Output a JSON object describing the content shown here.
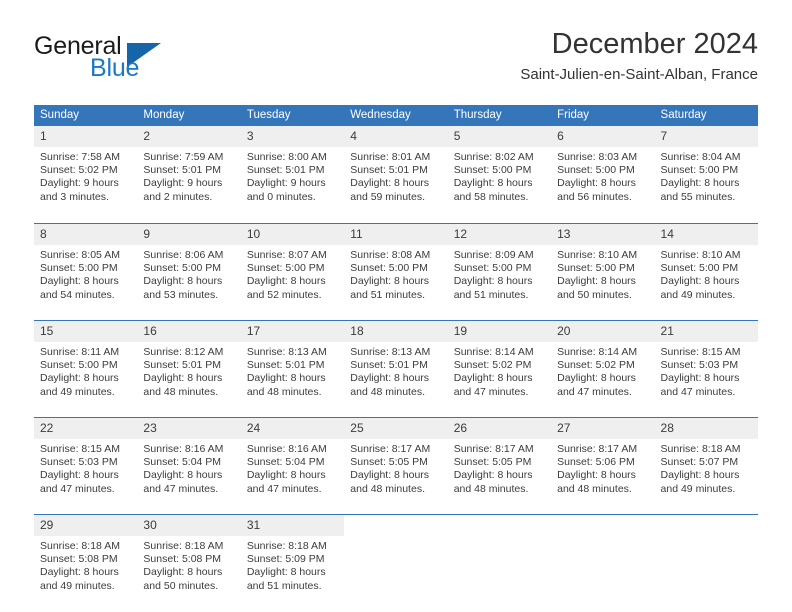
{
  "brand": {
    "name_top": "General",
    "name_bottom": "Blue",
    "triangle_color": "#1565a8",
    "blue_color": "#1b78c8"
  },
  "header": {
    "title": "December 2024",
    "subtitle": "Saint-Julien-en-Saint-Alban, France"
  },
  "theme": {
    "header_blue": "#3576ba",
    "daynum_gray": "#efefef",
    "text": "#3c3c3c"
  },
  "calendar": {
    "weekday_headers": [
      "Sunday",
      "Monday",
      "Tuesday",
      "Wednesday",
      "Thursday",
      "Friday",
      "Saturday"
    ],
    "weeks": [
      [
        {
          "day": "1",
          "info": "Sunrise: 7:58 AM\nSunset: 5:02 PM\nDaylight: 9 hours\nand 3 minutes."
        },
        {
          "day": "2",
          "info": "Sunrise: 7:59 AM\nSunset: 5:01 PM\nDaylight: 9 hours\nand 2 minutes."
        },
        {
          "day": "3",
          "info": "Sunrise: 8:00 AM\nSunset: 5:01 PM\nDaylight: 9 hours\nand 0 minutes."
        },
        {
          "day": "4",
          "info": "Sunrise: 8:01 AM\nSunset: 5:01 PM\nDaylight: 8 hours\nand 59 minutes."
        },
        {
          "day": "5",
          "info": "Sunrise: 8:02 AM\nSunset: 5:00 PM\nDaylight: 8 hours\nand 58 minutes."
        },
        {
          "day": "6",
          "info": "Sunrise: 8:03 AM\nSunset: 5:00 PM\nDaylight: 8 hours\nand 56 minutes."
        },
        {
          "day": "7",
          "info": "Sunrise: 8:04 AM\nSunset: 5:00 PM\nDaylight: 8 hours\nand 55 minutes."
        }
      ],
      [
        {
          "day": "8",
          "info": "Sunrise: 8:05 AM\nSunset: 5:00 PM\nDaylight: 8 hours\nand 54 minutes."
        },
        {
          "day": "9",
          "info": "Sunrise: 8:06 AM\nSunset: 5:00 PM\nDaylight: 8 hours\nand 53 minutes."
        },
        {
          "day": "10",
          "info": "Sunrise: 8:07 AM\nSunset: 5:00 PM\nDaylight: 8 hours\nand 52 minutes."
        },
        {
          "day": "11",
          "info": "Sunrise: 8:08 AM\nSunset: 5:00 PM\nDaylight: 8 hours\nand 51 minutes."
        },
        {
          "day": "12",
          "info": "Sunrise: 8:09 AM\nSunset: 5:00 PM\nDaylight: 8 hours\nand 51 minutes."
        },
        {
          "day": "13",
          "info": "Sunrise: 8:10 AM\nSunset: 5:00 PM\nDaylight: 8 hours\nand 50 minutes."
        },
        {
          "day": "14",
          "info": "Sunrise: 8:10 AM\nSunset: 5:00 PM\nDaylight: 8 hours\nand 49 minutes."
        }
      ],
      [
        {
          "day": "15",
          "info": "Sunrise: 8:11 AM\nSunset: 5:00 PM\nDaylight: 8 hours\nand 49 minutes."
        },
        {
          "day": "16",
          "info": "Sunrise: 8:12 AM\nSunset: 5:01 PM\nDaylight: 8 hours\nand 48 minutes."
        },
        {
          "day": "17",
          "info": "Sunrise: 8:13 AM\nSunset: 5:01 PM\nDaylight: 8 hours\nand 48 minutes."
        },
        {
          "day": "18",
          "info": "Sunrise: 8:13 AM\nSunset: 5:01 PM\nDaylight: 8 hours\nand 48 minutes."
        },
        {
          "day": "19",
          "info": "Sunrise: 8:14 AM\nSunset: 5:02 PM\nDaylight: 8 hours\nand 47 minutes."
        },
        {
          "day": "20",
          "info": "Sunrise: 8:14 AM\nSunset: 5:02 PM\nDaylight: 8 hours\nand 47 minutes."
        },
        {
          "day": "21",
          "info": "Sunrise: 8:15 AM\nSunset: 5:03 PM\nDaylight: 8 hours\nand 47 minutes."
        }
      ],
      [
        {
          "day": "22",
          "info": "Sunrise: 8:15 AM\nSunset: 5:03 PM\nDaylight: 8 hours\nand 47 minutes."
        },
        {
          "day": "23",
          "info": "Sunrise: 8:16 AM\nSunset: 5:04 PM\nDaylight: 8 hours\nand 47 minutes."
        },
        {
          "day": "24",
          "info": "Sunrise: 8:16 AM\nSunset: 5:04 PM\nDaylight: 8 hours\nand 47 minutes."
        },
        {
          "day": "25",
          "info": "Sunrise: 8:17 AM\nSunset: 5:05 PM\nDaylight: 8 hours\nand 48 minutes."
        },
        {
          "day": "26",
          "info": "Sunrise: 8:17 AM\nSunset: 5:05 PM\nDaylight: 8 hours\nand 48 minutes."
        },
        {
          "day": "27",
          "info": "Sunrise: 8:17 AM\nSunset: 5:06 PM\nDaylight: 8 hours\nand 48 minutes."
        },
        {
          "day": "28",
          "info": "Sunrise: 8:18 AM\nSunset: 5:07 PM\nDaylight: 8 hours\nand 49 minutes."
        }
      ],
      [
        {
          "day": "29",
          "info": "Sunrise: 8:18 AM\nSunset: 5:08 PM\nDaylight: 8 hours\nand 49 minutes."
        },
        {
          "day": "30",
          "info": "Sunrise: 8:18 AM\nSunset: 5:08 PM\nDaylight: 8 hours\nand 50 minutes."
        },
        {
          "day": "31",
          "info": "Sunrise: 8:18 AM\nSunset: 5:09 PM\nDaylight: 8 hours\nand 51 minutes."
        },
        {
          "day": "",
          "info": ""
        },
        {
          "day": "",
          "info": ""
        },
        {
          "day": "",
          "info": ""
        },
        {
          "day": "",
          "info": ""
        }
      ]
    ]
  }
}
